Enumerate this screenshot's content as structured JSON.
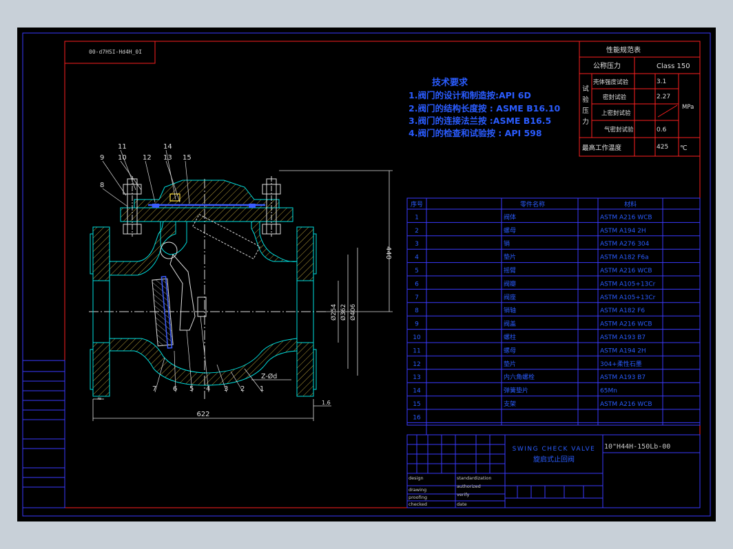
{
  "drawing": {
    "stamp": "00-d7HSI-Hd4H_0I",
    "code": "10\"H44H-150Lb-00",
    "title_en": "SWING CHECK VALVE",
    "title_cn": "旋启式止回阀"
  },
  "tech_requirements": {
    "heading": "技术要求",
    "items": [
      "1.阀门的设计和制造按:API 6D",
      "2.阀门的结构长度按 : ASME B16.10",
      "3.阀门的连接法兰按 :ASME B16.5",
      "4.阀门的检查和试验按 : API 598"
    ]
  },
  "performance": {
    "title": "性能规范表",
    "nominal_label": "公称压力",
    "nominal_value": "Class 150",
    "test_label": [
      "试",
      "验",
      "压",
      "力"
    ],
    "rows": [
      {
        "label": "壳体强度试验",
        "value": "3.1"
      },
      {
        "label": "密封试验",
        "value": "2.27"
      },
      {
        "label": "上密封试验",
        "value": ""
      },
      {
        "label": "气密封试验",
        "value": "0.6"
      }
    ],
    "unit": "MPa",
    "temp_label": "最高工作温度",
    "temp_value": "425",
    "temp_unit": "℃"
  },
  "parts_table": {
    "headers": [
      "序号",
      "零件名称",
      "",
      "材料"
    ],
    "rows": [
      {
        "no": "1",
        "name": "阀体",
        "mat": "ASTM A216 WCB"
      },
      {
        "no": "2",
        "name": "螺母",
        "mat": "ASTM A194 2H"
      },
      {
        "no": "3",
        "name": "销",
        "mat": "ASTM A276 304"
      },
      {
        "no": "4",
        "name": "垫片",
        "mat": "ASTM A182 F6a"
      },
      {
        "no": "5",
        "name": "摇臂",
        "mat": "ASTM A216 WCB"
      },
      {
        "no": "6",
        "name": "阀瓣",
        "mat": "ASTM A105+13Cr"
      },
      {
        "no": "7",
        "name": "阀座",
        "mat": "ASTM A105+13Cr"
      },
      {
        "no": "8",
        "name": "销轴",
        "mat": "ASTM A182 F6"
      },
      {
        "no": "9",
        "name": "阀盖",
        "mat": "ASTM A216 WCB"
      },
      {
        "no": "10",
        "name": "螺柱",
        "mat": "ASTM A193 B7"
      },
      {
        "no": "11",
        "name": "螺母",
        "mat": "ASTM A194 2H"
      },
      {
        "no": "12",
        "name": "垫片",
        "mat": "304+柔性石墨"
      },
      {
        "no": "13",
        "name": "内六角螺栓",
        "mat": "ASTM A193 B7"
      },
      {
        "no": "14",
        "name": "弹簧垫片",
        "mat": "65Mn"
      },
      {
        "no": "15",
        "name": "支架",
        "mat": "ASTM A216 WCB"
      },
      {
        "no": "16",
        "name": "",
        "mat": ""
      }
    ]
  },
  "title_block": {
    "left_labels": [
      "design",
      "drawing",
      "proofing",
      "checked"
    ],
    "right_labels": [
      "standardization",
      "authorized",
      "verify",
      "date"
    ]
  },
  "dimensions": {
    "length": "622",
    "height": "440",
    "d1": "Ø254",
    "d2": "Ø362",
    "d3": "Ø406",
    "holes": "Z-Ød",
    "raised_face": "1.6",
    "left_small": "≈"
  },
  "callouts": [
    "9",
    "11",
    "10",
    "12",
    "14",
    "13",
    "15",
    "8",
    "7",
    "6",
    "5",
    "4",
    "3",
    "2",
    "1"
  ]
}
